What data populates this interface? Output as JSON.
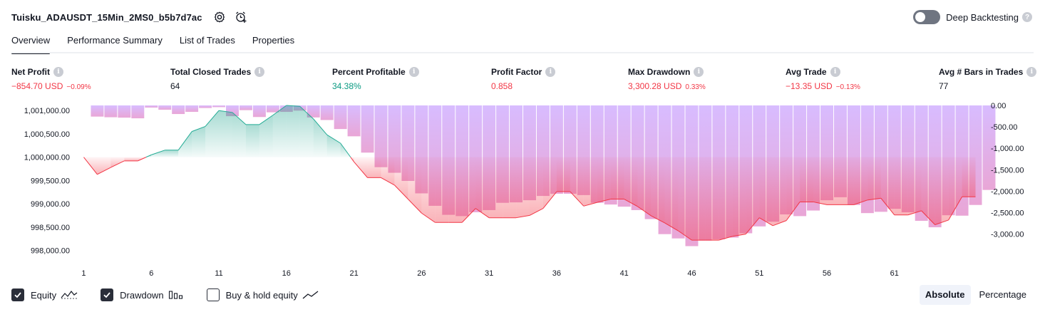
{
  "header": {
    "strategy_name": "Tuisku_ADAUSDT_15Min_2MS0_b5b7d7ac",
    "settings_icon": "gear-icon",
    "alert_icon": "alarm-clock-plus-icon",
    "deep_backtesting_label": "Deep Backtesting",
    "deep_backtesting_enabled": false,
    "help_glyph": "?"
  },
  "tabs": [
    {
      "label": "Overview",
      "active": true
    },
    {
      "label": "Performance Summary",
      "active": false
    },
    {
      "label": "List of Trades",
      "active": false
    },
    {
      "label": "Properties",
      "active": false
    }
  ],
  "metrics": [
    {
      "label": "Net Profit",
      "value": "−854.70 USD",
      "pct": "−0.09%",
      "tone": "neg"
    },
    {
      "label": "Total Closed Trades",
      "value": "64",
      "pct": "",
      "tone": "neu"
    },
    {
      "label": "Percent Profitable",
      "value": "34.38%",
      "pct": "",
      "tone": "pos"
    },
    {
      "label": "Profit Factor",
      "value": "0.858",
      "pct": "",
      "tone": "neg"
    },
    {
      "label": "Max Drawdown",
      "value": "3,300.28 USD",
      "pct": "0.33%",
      "tone": "neg"
    },
    {
      "label": "Avg Trade",
      "value": "−13.35 USD",
      "pct": "−0.13%",
      "tone": "neg"
    },
    {
      "label": "Avg # Bars in Trades",
      "value": "77",
      "pct": "",
      "tone": "neu"
    }
  ],
  "info_glyph": "i",
  "chart_data": {
    "type": "line",
    "series": [
      {
        "name": "Equity",
        "type": "area",
        "baseline": 1000000,
        "values": [
          1000000,
          999630,
          999780,
          999920,
          999920,
          1000050,
          1000150,
          1000150,
          1000550,
          1000660,
          1001000,
          1000960,
          1000700,
          1000700,
          1000900,
          1001110,
          1001090,
          1000820,
          1000480,
          1000300,
          999900,
          999560,
          999560,
          999400,
          999100,
          998800,
          998600,
          998600,
          998600,
          998900,
          998700,
          998700,
          998700,
          998750,
          998900,
          999260,
          999260,
          998950,
          999030,
          999100,
          999100,
          998940,
          998740,
          998590,
          998420,
          998220,
          998220,
          998220,
          998300,
          998350,
          998700,
          998530,
          998640,
          999040,
          999040,
          998980,
          998980,
          998980,
          999080,
          999120,
          998760,
          998760,
          998850,
          998550,
          998650,
          999150,
          999150
        ]
      },
      {
        "name": "Drawdown",
        "type": "bar",
        "values": [
          0,
          -260,
          -275,
          -285,
          -300,
          -50,
          -100,
          -200,
          -150,
          -60,
          -40,
          -250,
          -110,
          -270,
          -160,
          -150,
          -120,
          -280,
          -340,
          -550,
          -720,
          -1100,
          -1440,
          -1570,
          -1760,
          -2050,
          -2340,
          -2550,
          -2580,
          -2490,
          -2440,
          -2270,
          -2260,
          -2210,
          -2110,
          -2060,
          -2060,
          -2090,
          -2270,
          -2310,
          -2360,
          -2440,
          -2650,
          -3000,
          -3100,
          -3280,
          -3150,
          -3120,
          -3080,
          -2980,
          -2820,
          -2710,
          -2540,
          -2580,
          -2450,
          -2210,
          -2140,
          -2320,
          -2510,
          -2480,
          -2410,
          -2490,
          -2690,
          -2840,
          -2560,
          -2570,
          -2320,
          -1970
        ]
      }
    ],
    "x_ticks": [
      1,
      6,
      11,
      16,
      21,
      26,
      31,
      36,
      41,
      46,
      51,
      56,
      61
    ],
    "x_range": [
      1,
      67
    ],
    "left_axis": {
      "labels": [
        "1,001,000.00",
        "1,000,500.00",
        "1,000,000.00",
        "999,500.00",
        "999,000.00",
        "998,500.00",
        "998,000.00"
      ],
      "values": [
        1001000,
        1000500,
        1000000,
        999500,
        999000,
        998500,
        998000
      ],
      "ylim": [
        997870,
        1001110
      ]
    },
    "right_axis": {
      "labels": [
        "0.00",
        "-500.00",
        "-1,000.00",
        "-1,500.00",
        "-2,000.00",
        "-2,500.00",
        "-3,000.00"
      ],
      "values": [
        0,
        -500,
        -1000,
        -1500,
        -2000,
        -2500,
        -3000
      ],
      "ylim": [
        -3520,
        0
      ]
    },
    "colors": {
      "gain_line": "#22ab94",
      "loss_line": "#f23645",
      "gain_fill": "#089981",
      "loss_fill": "#f23645",
      "drawdown_bar": "#d8bcff"
    },
    "grid": false,
    "legend_position": "bottom-left"
  },
  "legend": [
    {
      "label": "Equity",
      "checked": true,
      "icon": "equity-zigzag-icon"
    },
    {
      "label": "Drawdown",
      "checked": true,
      "icon": "drawdown-bars-icon"
    },
    {
      "label": "Buy & hold equity",
      "checked": false,
      "icon": "buy-hold-line-icon"
    }
  ],
  "mode": {
    "absolute_label": "Absolute",
    "percentage_label": "Percentage",
    "selected": "absolute"
  }
}
